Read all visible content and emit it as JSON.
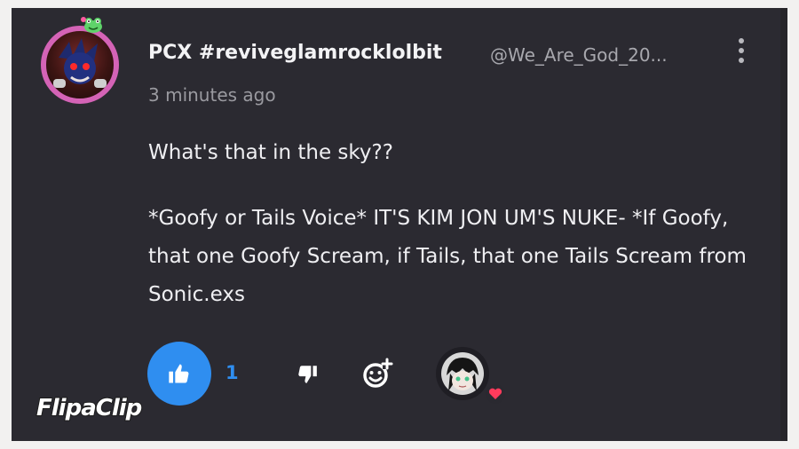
{
  "post": {
    "author": "PCX #reviveglamrocklolbit",
    "handle": "@We_Are_God_20...",
    "timestamp": "3 minutes ago",
    "body": [
      "What's that in the sky??",
      "*Goofy or Tails Voice* IT'S KIM JON UM'S NUKE- *If Goofy, that one Goofy Scream, if Tails, that one Tails Scream from Sonic.exs"
    ],
    "avatar_icon": "user-avatar-icon",
    "badge_icon": "frog-badge-icon"
  },
  "actions": {
    "like_count": "1",
    "like_icon": "thumbs-up-icon",
    "dislike_icon": "thumbs-down-icon",
    "react_icon": "add-reaction-icon",
    "more_icon": "more-vertical-icon",
    "heart_icon": "heart-icon"
  },
  "watermark": {
    "text": "FlipaClip"
  },
  "colors": {
    "card_background": "#2b2a31",
    "accent_blue": "#2f8ef0",
    "avatar_ring": "#d463b6",
    "heart": "#ff3b5c"
  }
}
